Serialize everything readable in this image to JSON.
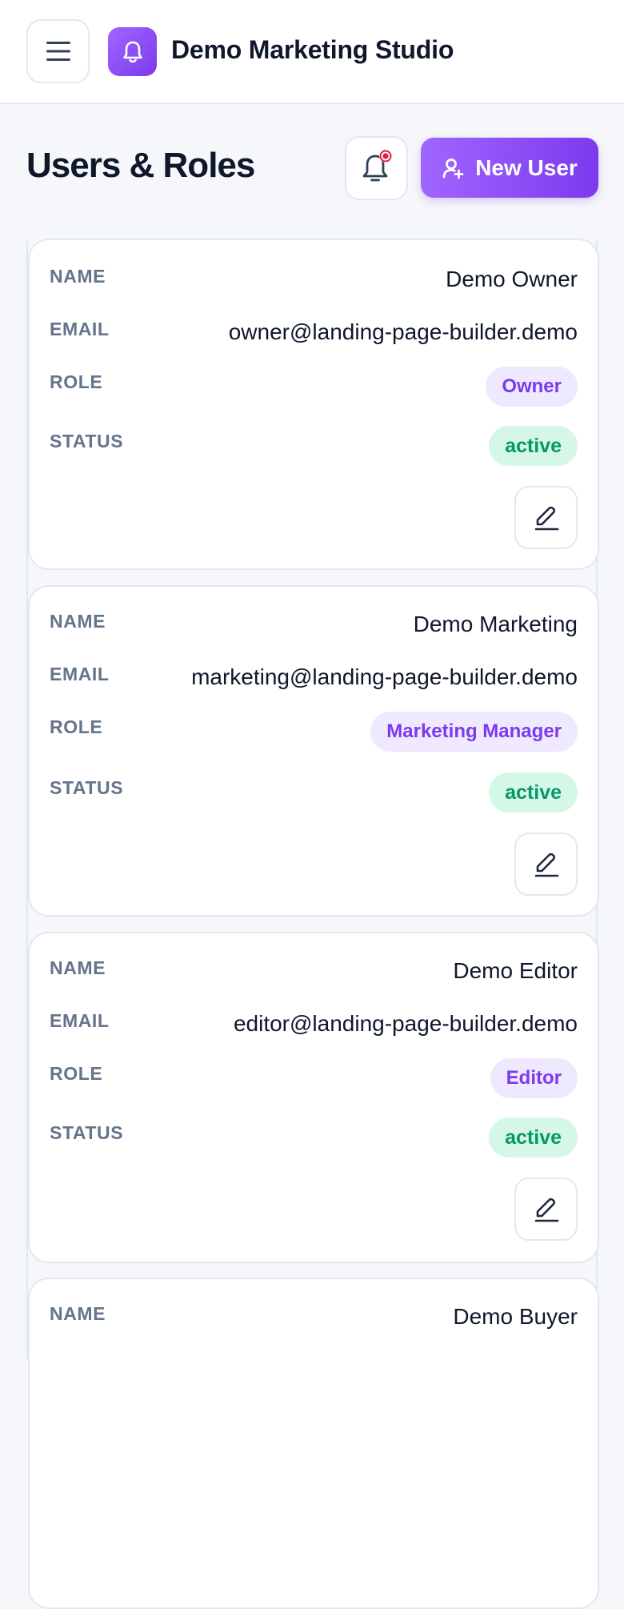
{
  "header": {
    "brand_name": "Demo Marketing Studio",
    "menu_icon": "hamburger-menu-icon",
    "logo_icon": "bell-icon"
  },
  "page": {
    "title": "Users & Roles",
    "new_user_label": "New User",
    "notification_icon": "bell-icon",
    "notification_dot_color": "#e11d48",
    "accent_color": "#7c3aed"
  },
  "labels": {
    "name": "NAME",
    "email": "EMAIL",
    "role": "ROLE",
    "status": "STATUS"
  },
  "users": [
    {
      "name": "Demo Owner",
      "email": "owner@landing-page-builder.demo",
      "role": "Owner",
      "status": "active"
    },
    {
      "name": "Demo Marketing",
      "email": "marketing@landing-page-builder.demo",
      "role": "Marketing Manager",
      "status": "active"
    },
    {
      "name": "Demo Editor",
      "email": "editor@landing-page-builder.demo",
      "role": "Editor",
      "status": "active"
    },
    {
      "name": "Demo Buyer"
    }
  ]
}
